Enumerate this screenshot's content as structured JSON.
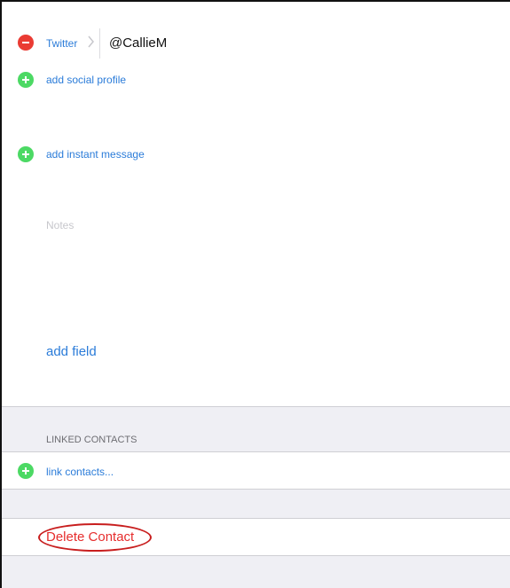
{
  "twitter": {
    "service_label": "Twitter",
    "value": "@CallieM"
  },
  "social": {
    "add_label": "add social profile"
  },
  "instant_message": {
    "add_label": "add instant message"
  },
  "notes": {
    "placeholder": "Notes"
  },
  "add_field": {
    "label": "add field"
  },
  "linked_contacts": {
    "header": "LINKED CONTACTS",
    "link_label": "link contacts..."
  },
  "delete": {
    "label": "Delete Contact"
  },
  "colors": {
    "accent": "#2b7cd9",
    "remove_red": "#ea3b33",
    "add_green": "#4cd964",
    "delete_red": "#e62d2d",
    "group_bg": "#efeff4",
    "annotation_ring": "#c81e1e"
  },
  "icons": [
    "remove-circle-icon",
    "chevron-right-icon",
    "add-circle-icon"
  ]
}
